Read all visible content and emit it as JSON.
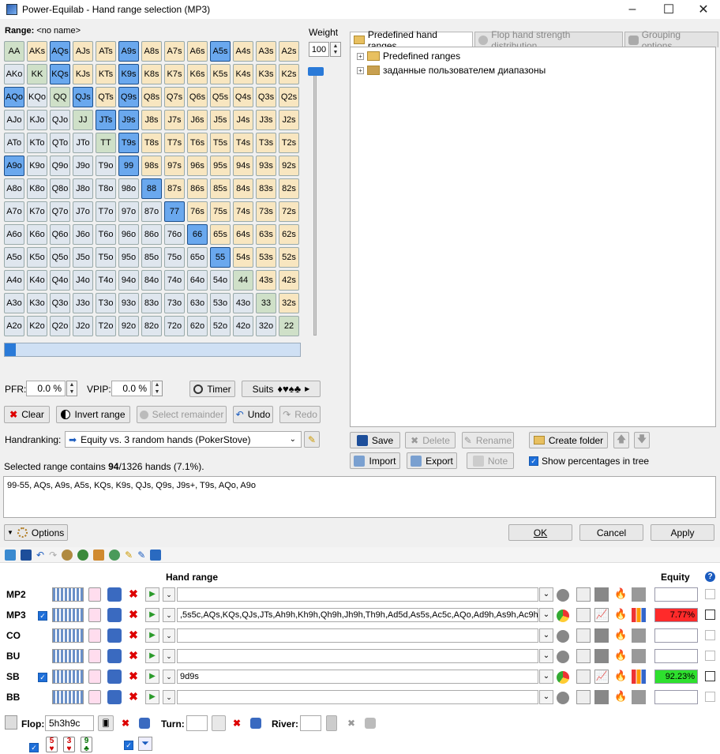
{
  "window": {
    "title": "Power-Equilab - Hand range selection (MP3)"
  },
  "range": {
    "label": "Range:",
    "name": "<no name>"
  },
  "grid": {
    "cells": [
      [
        "AA",
        "p"
      ],
      [
        "AKs",
        "s"
      ],
      [
        "AQs",
        "ssel"
      ],
      [
        "AJs",
        "s"
      ],
      [
        "ATs",
        "s"
      ],
      [
        "A9s",
        "ssel"
      ],
      [
        "A8s",
        "s"
      ],
      [
        "A7s",
        "s"
      ],
      [
        "A6s",
        "s"
      ],
      [
        "A5s",
        "ssel"
      ],
      [
        "A4s",
        "s"
      ],
      [
        "A3s",
        "s"
      ],
      [
        "A2s",
        "s"
      ],
      [
        "AKo",
        "o"
      ],
      [
        "KK",
        "p"
      ],
      [
        "KQs",
        "ssel"
      ],
      [
        "KJs",
        "s"
      ],
      [
        "KTs",
        "s"
      ],
      [
        "K9s",
        "ssel"
      ],
      [
        "K8s",
        "s"
      ],
      [
        "K7s",
        "s"
      ],
      [
        "K6s",
        "s"
      ],
      [
        "K5s",
        "s"
      ],
      [
        "K4s",
        "s"
      ],
      [
        "K3s",
        "s"
      ],
      [
        "K2s",
        "s"
      ],
      [
        "AQo",
        "osel"
      ],
      [
        "KQo",
        "o"
      ],
      [
        "QQ",
        "p"
      ],
      [
        "QJs",
        "ssel"
      ],
      [
        "QTs",
        "s"
      ],
      [
        "Q9s",
        "ssel"
      ],
      [
        "Q8s",
        "s"
      ],
      [
        "Q7s",
        "s"
      ],
      [
        "Q6s",
        "s"
      ],
      [
        "Q5s",
        "s"
      ],
      [
        "Q4s",
        "s"
      ],
      [
        "Q3s",
        "s"
      ],
      [
        "Q2s",
        "s"
      ],
      [
        "AJo",
        "o"
      ],
      [
        "KJo",
        "o"
      ],
      [
        "QJo",
        "o"
      ],
      [
        "JJ",
        "p"
      ],
      [
        "JTs",
        "ssel"
      ],
      [
        "J9s",
        "ssel"
      ],
      [
        "J8s",
        "s"
      ],
      [
        "J7s",
        "s"
      ],
      [
        "J6s",
        "s"
      ],
      [
        "J5s",
        "s"
      ],
      [
        "J4s",
        "s"
      ],
      [
        "J3s",
        "s"
      ],
      [
        "J2s",
        "s"
      ],
      [
        "ATo",
        "o"
      ],
      [
        "KTo",
        "o"
      ],
      [
        "QTo",
        "o"
      ],
      [
        "JTo",
        "o"
      ],
      [
        "TT",
        "p"
      ],
      [
        "T9s",
        "ssel"
      ],
      [
        "T8s",
        "s"
      ],
      [
        "T7s",
        "s"
      ],
      [
        "T6s",
        "s"
      ],
      [
        "T5s",
        "s"
      ],
      [
        "T4s",
        "s"
      ],
      [
        "T3s",
        "s"
      ],
      [
        "T2s",
        "s"
      ],
      [
        "A9o",
        "osel"
      ],
      [
        "K9o",
        "o"
      ],
      [
        "Q9o",
        "o"
      ],
      [
        "J9o",
        "o"
      ],
      [
        "T9o",
        "o"
      ],
      [
        "99",
        "psel"
      ],
      [
        "98s",
        "s"
      ],
      [
        "97s",
        "s"
      ],
      [
        "96s",
        "s"
      ],
      [
        "95s",
        "s"
      ],
      [
        "94s",
        "s"
      ],
      [
        "93s",
        "s"
      ],
      [
        "92s",
        "s"
      ],
      [
        "A8o",
        "o"
      ],
      [
        "K8o",
        "o"
      ],
      [
        "Q8o",
        "o"
      ],
      [
        "J8o",
        "o"
      ],
      [
        "T8o",
        "o"
      ],
      [
        "98o",
        "o"
      ],
      [
        "88",
        "psel"
      ],
      [
        "87s",
        "s"
      ],
      [
        "86s",
        "s"
      ],
      [
        "85s",
        "s"
      ],
      [
        "84s",
        "s"
      ],
      [
        "83s",
        "s"
      ],
      [
        "82s",
        "s"
      ],
      [
        "A7o",
        "o"
      ],
      [
        "K7o",
        "o"
      ],
      [
        "Q7o",
        "o"
      ],
      [
        "J7o",
        "o"
      ],
      [
        "T7o",
        "o"
      ],
      [
        "97o",
        "o"
      ],
      [
        "87o",
        "o"
      ],
      [
        "77",
        "psel"
      ],
      [
        "76s",
        "s"
      ],
      [
        "75s",
        "s"
      ],
      [
        "74s",
        "s"
      ],
      [
        "73s",
        "s"
      ],
      [
        "72s",
        "s"
      ],
      [
        "A6o",
        "o"
      ],
      [
        "K6o",
        "o"
      ],
      [
        "Q6o",
        "o"
      ],
      [
        "J6o",
        "o"
      ],
      [
        "T6o",
        "o"
      ],
      [
        "96o",
        "o"
      ],
      [
        "86o",
        "o"
      ],
      [
        "76o",
        "o"
      ],
      [
        "66",
        "psel"
      ],
      [
        "65s",
        "s"
      ],
      [
        "64s",
        "s"
      ],
      [
        "63s",
        "s"
      ],
      [
        "62s",
        "s"
      ],
      [
        "A5o",
        "o"
      ],
      [
        "K5o",
        "o"
      ],
      [
        "Q5o",
        "o"
      ],
      [
        "J5o",
        "o"
      ],
      [
        "T5o",
        "o"
      ],
      [
        "95o",
        "o"
      ],
      [
        "85o",
        "o"
      ],
      [
        "75o",
        "o"
      ],
      [
        "65o",
        "o"
      ],
      [
        "55",
        "psel"
      ],
      [
        "54s",
        "s"
      ],
      [
        "53s",
        "s"
      ],
      [
        "52s",
        "s"
      ],
      [
        "A4o",
        "o"
      ],
      [
        "K4o",
        "o"
      ],
      [
        "Q4o",
        "o"
      ],
      [
        "J4o",
        "o"
      ],
      [
        "T4o",
        "o"
      ],
      [
        "94o",
        "o"
      ],
      [
        "84o",
        "o"
      ],
      [
        "74o",
        "o"
      ],
      [
        "64o",
        "o"
      ],
      [
        "54o",
        "o"
      ],
      [
        "44",
        "p"
      ],
      [
        "43s",
        "s"
      ],
      [
        "42s",
        "s"
      ],
      [
        "A3o",
        "o"
      ],
      [
        "K3o",
        "o"
      ],
      [
        "Q3o",
        "o"
      ],
      [
        "J3o",
        "o"
      ],
      [
        "T3o",
        "o"
      ],
      [
        "93o",
        "o"
      ],
      [
        "83o",
        "o"
      ],
      [
        "73o",
        "o"
      ],
      [
        "63o",
        "o"
      ],
      [
        "53o",
        "o"
      ],
      [
        "43o",
        "o"
      ],
      [
        "33",
        "p"
      ],
      [
        "32s",
        "s"
      ],
      [
        "A2o",
        "o"
      ],
      [
        "K2o",
        "o"
      ],
      [
        "Q2o",
        "o"
      ],
      [
        "J2o",
        "o"
      ],
      [
        "T2o",
        "o"
      ],
      [
        "92o",
        "o"
      ],
      [
        "82o",
        "o"
      ],
      [
        "72o",
        "o"
      ],
      [
        "62o",
        "o"
      ],
      [
        "52o",
        "o"
      ],
      [
        "42o",
        "o"
      ],
      [
        "32o",
        "o"
      ],
      [
        "22",
        "p"
      ]
    ]
  },
  "weight": {
    "label": "Weight",
    "value": "100"
  },
  "pfr": {
    "label": "PFR:",
    "value": "0.0 %"
  },
  "vpip": {
    "label": "VPIP:",
    "value": "0.0 %"
  },
  "buttons": {
    "timer": "Timer",
    "suits": "Suits",
    "clear": "Clear",
    "invert": "Invert range",
    "select_remainder": "Select remainder",
    "undo": "Undo",
    "redo": "Redo",
    "save": "Save",
    "delete": "Delete",
    "rename": "Rename",
    "create_folder": "Create folder",
    "import": "Import",
    "export": "Export",
    "note": "Note",
    "options": "Options",
    "ok": "OK",
    "cancel": "Cancel",
    "apply": "Apply"
  },
  "suits_glyphs": "♦♥♠♣",
  "handranking": {
    "label": "Handranking:",
    "value": "Equity vs. 3 random hands (PokerStove)"
  },
  "tabs": [
    {
      "label": "Predefined hand ranges"
    },
    {
      "label": "Flop hand strength distribution"
    },
    {
      "label": "Grouping options"
    }
  ],
  "tree": [
    {
      "label": "Predefined ranges"
    },
    {
      "label": "заданные пользователем диапазоны"
    }
  ],
  "show_percentages": "Show percentages in tree",
  "summary": {
    "prefix": "Selected range contains ",
    "count": "94",
    "suffix": "/1326 hands (7.1%)."
  },
  "range_text": "99-55, AQs, A9s, A5s, KQs, K9s, QJs, Q9s, J9s+, T9s, AQo, A9o",
  "main": {
    "hand_range_header": "Hand range",
    "equity_header": "Equity",
    "players": [
      {
        "seat": "MP2",
        "range": "",
        "equity": "",
        "checked": false
      },
      {
        "seat": "MP3",
        "range": ",5s5c,AQs,KQs,QJs,JTs,Ah9h,Kh9h,Qh9h,Jh9h,Th9h,Ad5d,As5s,Ac5c,AQo,Ad9h,As9h,Ac9h",
        "equity": "7.77%",
        "checked": true
      },
      {
        "seat": "CO",
        "range": "",
        "equity": "",
        "checked": false
      },
      {
        "seat": "BU",
        "range": "",
        "equity": "",
        "checked": false
      },
      {
        "seat": "SB",
        "range": "9d9s",
        "equity": "92.23%",
        "checked": true
      },
      {
        "seat": "BB",
        "range": "",
        "equity": "",
        "checked": false
      }
    ]
  },
  "board": {
    "flop_label": "Flop:",
    "flop_value": "5h3h9c",
    "turn_label": "Turn:",
    "river_label": "River:",
    "cards": [
      {
        "rank": "5",
        "suit": "♥",
        "color": "#d00000"
      },
      {
        "rank": "3",
        "suit": "♥",
        "color": "#d00000"
      },
      {
        "rank": "9",
        "suit": "♣",
        "color": "#007000"
      }
    ]
  },
  "colors": {
    "selected": "#6aa8ee",
    "suited": "#f8e6c0",
    "offsuit": "#dfe6ee",
    "pair": "#cfe0c8",
    "equity_low": "#ff2a2a",
    "equity_high": "#2ee02e"
  }
}
